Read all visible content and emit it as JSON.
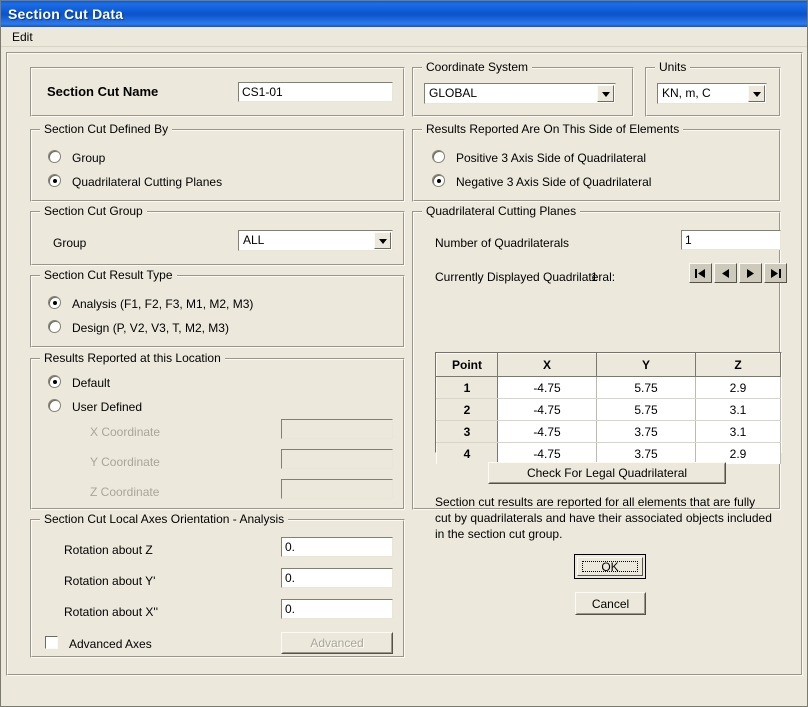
{
  "window": {
    "title": "Section Cut Data",
    "menu": [
      "Edit"
    ]
  },
  "section_cut_name": {
    "label": "Section Cut Name",
    "value": "CS1-01"
  },
  "coordinate_system": {
    "legend": "Coordinate System",
    "value": "GLOBAL"
  },
  "units": {
    "legend": "Units",
    "value": "KN, m, C"
  },
  "defined_by": {
    "legend": "Section Cut Defined By",
    "options": [
      {
        "label": "Group",
        "selected": false
      },
      {
        "label": "Quadrilateral Cutting Planes",
        "selected": true
      }
    ]
  },
  "results_side": {
    "legend": "Results Reported Are On This Side of Elements",
    "options": [
      {
        "label": "Positive 3 Axis Side of Quadrilateral",
        "selected": false
      },
      {
        "label": "Negative 3 Axis Side of Quadrilateral",
        "selected": true
      }
    ]
  },
  "section_cut_group": {
    "legend": "Section Cut Group",
    "label": "Group",
    "value": "ALL"
  },
  "result_type": {
    "legend": "Section Cut Result Type",
    "options": [
      {
        "label": "Analysis  (F1, F2, F3, M1, M2, M3)",
        "selected": true
      },
      {
        "label": "Design  (P, V2, V3, T, M2, M3)",
        "selected": false
      }
    ]
  },
  "results_location": {
    "legend": "Results Reported at this Location",
    "options": [
      {
        "label": "Default",
        "selected": true
      },
      {
        "label": "User Defined",
        "selected": false
      }
    ],
    "fields": [
      {
        "label": "X Coordinate",
        "value": "",
        "disabled": true
      },
      {
        "label": "Y Coordinate",
        "value": "",
        "disabled": true
      },
      {
        "label": "Z Coordinate",
        "value": "",
        "disabled": true
      }
    ]
  },
  "local_axes": {
    "legend": "Section Cut Local Axes Orientation - Analysis",
    "fields": [
      {
        "label": "Rotation about  Z",
        "value": "0."
      },
      {
        "label": "Rotation about  Y'",
        "value": "0."
      },
      {
        "label": "Rotation about  X''",
        "value": "0."
      }
    ],
    "advanced_checkbox": "Advanced Axes",
    "advanced_button": "Advanced"
  },
  "quad_planes": {
    "legend": "Quadrilateral Cutting Planes",
    "num_label": "Number of Quadrilaterals",
    "num_value": "1",
    "current_label": "Currently Displayed Quadrilateral:",
    "current_value": "1",
    "nav": [
      {
        "name": "first",
        "glyph": "first-record-icon"
      },
      {
        "name": "previous",
        "glyph": "previous-record-icon"
      },
      {
        "name": "next",
        "glyph": "next-record-icon"
      },
      {
        "name": "last",
        "glyph": "last-record-icon"
      }
    ],
    "table": {
      "headers": [
        "Point",
        "X",
        "Y",
        "Z"
      ],
      "rows": [
        [
          "1",
          "-4.75",
          "5.75",
          "2.9"
        ],
        [
          "2",
          "-4.75",
          "5.75",
          "3.1"
        ],
        [
          "3",
          "-4.75",
          "3.75",
          "3.1"
        ],
        [
          "4",
          "-4.75",
          "3.75",
          "2.9"
        ]
      ]
    },
    "check_button": "Check For Legal Quadrilateral",
    "note": "Section cut results are reported for all elements that are fully cut by quadrilaterals and have their associated objects included in the section cut group."
  },
  "actions": {
    "ok": "OK",
    "cancel": "Cancel"
  },
  "colors": {
    "dialog_face": "#ece9dc",
    "title_blue": "#0a55cf",
    "disabled_text": "#a9a598",
    "field_white": "#ffffff"
  }
}
